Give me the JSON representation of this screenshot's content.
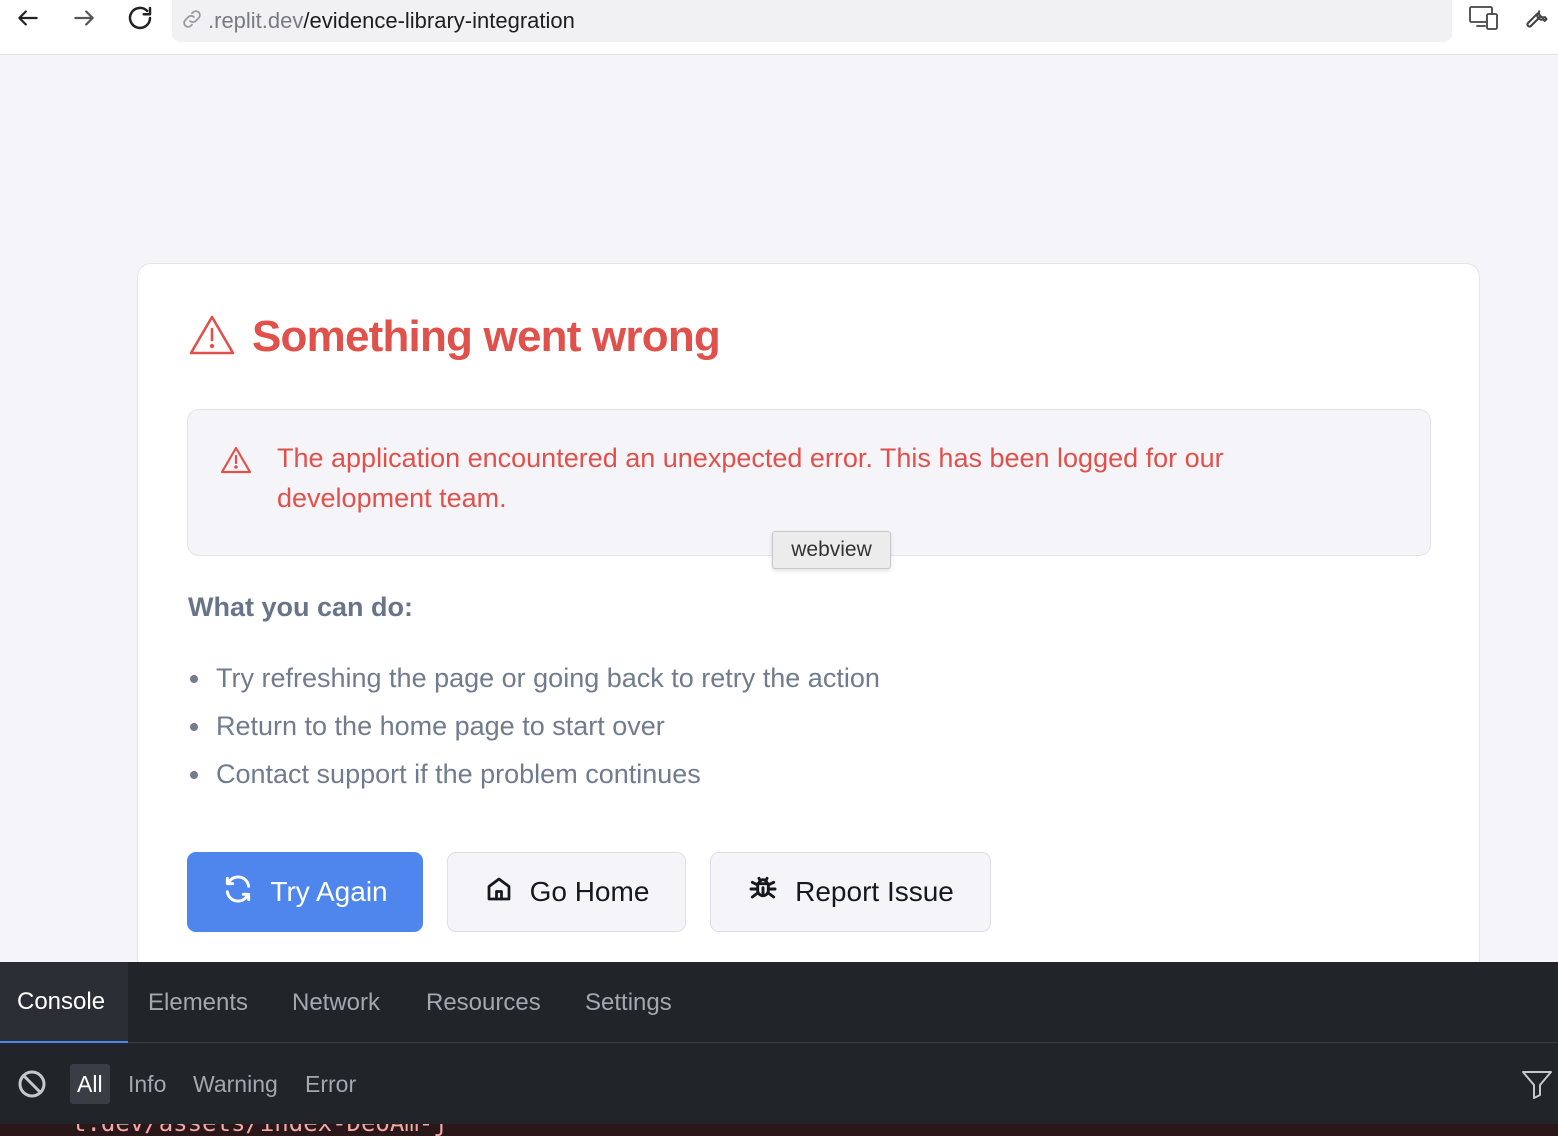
{
  "browser": {
    "url_host": ".replit.dev",
    "url_path": "/evidence-library-integration",
    "icons": [
      "back-arrow-icon",
      "forward-arrow-icon",
      "reload-icon",
      "link-icon",
      "responsive-devices-icon",
      "wrench-icon"
    ]
  },
  "error_page": {
    "title": "Something went wrong",
    "alert_message": "The application encountered an unexpected error. This has been logged for our development team.",
    "tooltip": "webview",
    "what_title": "What you can do:",
    "tips": [
      "Try refreshing the page or going back to retry the action",
      "Return to the home page to start over",
      "Contact support if the problem continues"
    ],
    "buttons": {
      "try_again": "Try Again",
      "go_home": "Go Home",
      "report_issue": "Report Issue"
    },
    "colors": {
      "error": "#e0514b",
      "primary": "#4f86ee",
      "muted_text": "#717b8e"
    }
  },
  "devtools": {
    "tabs": [
      "Console",
      "Elements",
      "Network",
      "Resources",
      "Settings"
    ],
    "active_tab": "Console",
    "filters": [
      "All",
      "Info",
      "Warning",
      "Error"
    ],
    "active_filter": "All",
    "partial_log_line": "t.dev/assets/index-DeoAm-j"
  }
}
